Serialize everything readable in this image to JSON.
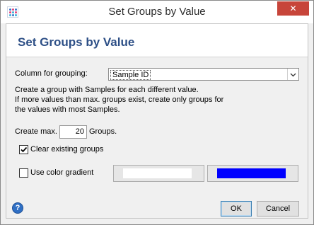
{
  "window": {
    "title": "Set Groups by Value",
    "close_label": "✕"
  },
  "header": {
    "title": "Set Groups by Value"
  },
  "column": {
    "label": "Column for grouping:",
    "selected": "Sample ID"
  },
  "description": {
    "line1": "Create a group with Samples for each different value.",
    "line2": "If more values than max. groups exist, create only groups for",
    "line3": "the values with most Samples."
  },
  "max_groups": {
    "prefix": "Create max.",
    "value": "20",
    "suffix": "Groups."
  },
  "clear_existing": {
    "label": "Clear existing groups",
    "checked": true
  },
  "gradient": {
    "label": "Use color gradient",
    "checked": false,
    "start_color": "#ffffff",
    "end_color": "#0000ff"
  },
  "buttons": {
    "ok": "OK",
    "cancel": "Cancel",
    "help": "?"
  },
  "icons": {
    "app": "app-icon",
    "help": "help-icon",
    "dropdown": "chevron-down-icon",
    "close": "close-icon",
    "check": "checkmark-icon"
  }
}
